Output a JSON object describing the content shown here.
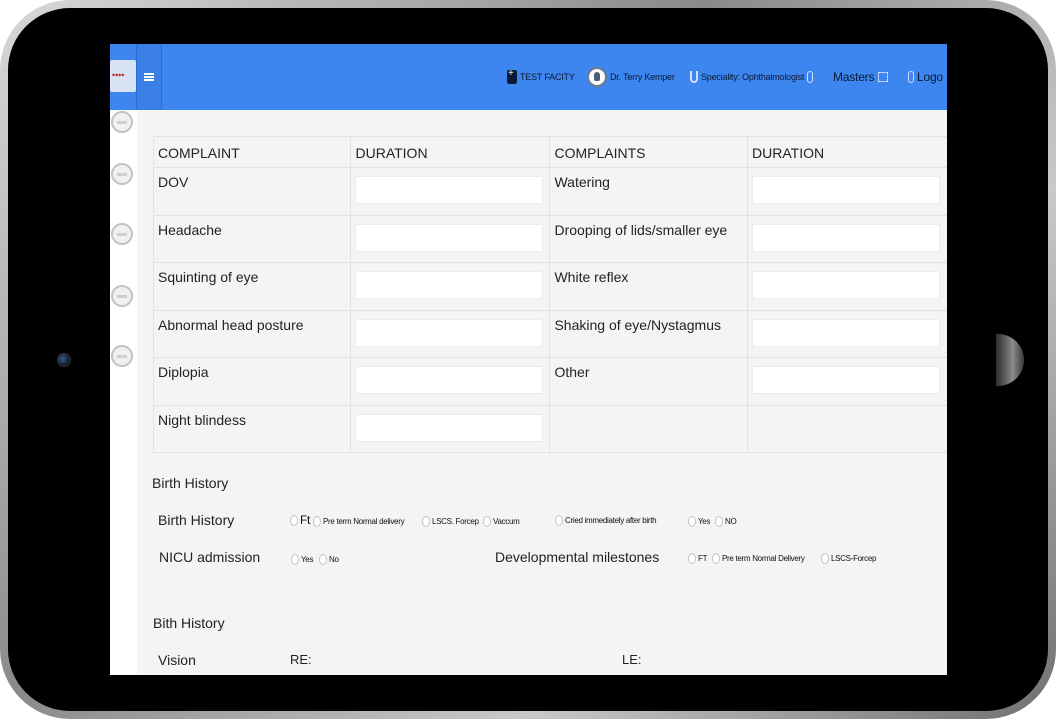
{
  "header": {
    "facility": "TEST FACITY",
    "doctor": "Dr. Terry Kemper",
    "speciality": "Speciality: Ophthalmologist",
    "masters": "Masters",
    "logout": "Logo"
  },
  "complaints_table": {
    "headers": [
      "COMPLAINT",
      "DURATION",
      "COMPLAINTS",
      "DURATION"
    ],
    "rows": [
      {
        "left": "DOV",
        "right": "Watering"
      },
      {
        "left": "Headache",
        "right": "Drooping of lids/smaller eye"
      },
      {
        "left": "Squinting of eye",
        "right": "White reflex"
      },
      {
        "left": "Abnormal head posture",
        "right": "Shaking of eye/Nystagmus"
      },
      {
        "left": "Diplopia",
        "right": "Other"
      },
      {
        "left": "Night blindess",
        "right": ""
      }
    ]
  },
  "birth_history": {
    "section_title": "Birth History",
    "row_label": "Birth History",
    "options": [
      "Ft",
      "Pre term Normal delivery",
      "LSCS. Forcep",
      "Vaccum"
    ],
    "cried_label": "Cried immediately after birth",
    "cried_options": [
      "Yes",
      "NO"
    ],
    "nicu_label": "NICU admission",
    "nicu_options": [
      "Yes",
      "No"
    ],
    "milestones_label": "Developmental milestones",
    "milestones_options": [
      "FT",
      "Pre term Normal Delivery",
      "LSCS-Forcep"
    ]
  },
  "bith_history": {
    "section_title": "Bith History",
    "vision_label": "Vision",
    "re_label": "RE:",
    "le_label": "LE:"
  }
}
